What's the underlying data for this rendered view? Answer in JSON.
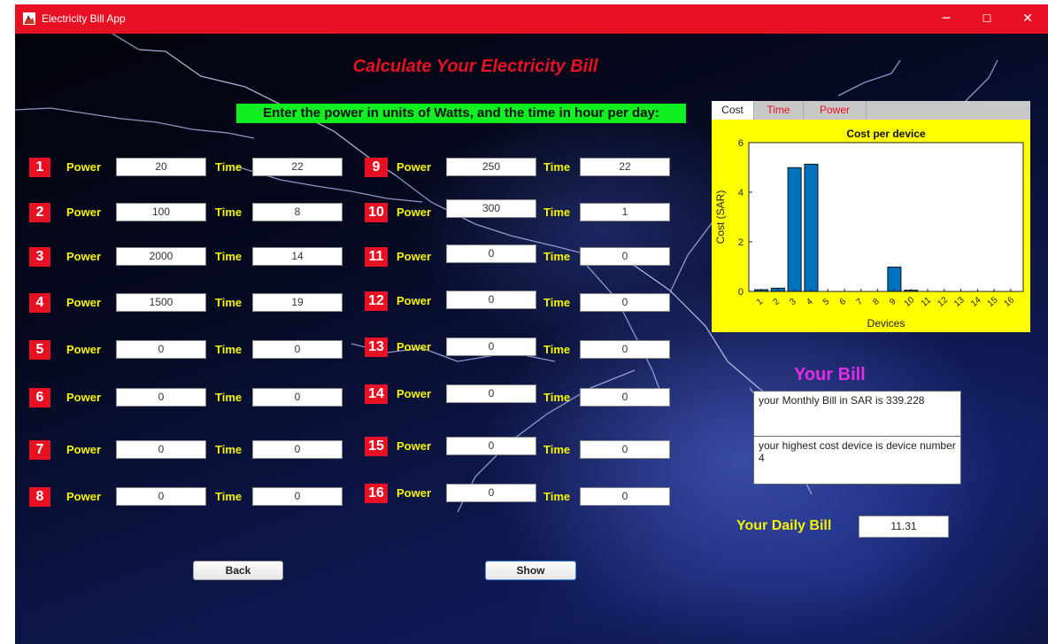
{
  "window": {
    "title": "Electricity Bill App",
    "minimize_glyph": "─",
    "maximize_glyph": "☐",
    "close_glyph": "✕",
    "app_icon": "mountain-app-icon",
    "accent": "#e81123"
  },
  "header": {
    "title": "Calculate Your Electricity Bill",
    "instructions": "Enter the power in units of Watts, and the time in hour per day:"
  },
  "labels": {
    "power": "Power",
    "time": "Time"
  },
  "devices": [
    {
      "num": "1",
      "power": "20",
      "time": "22"
    },
    {
      "num": "2",
      "power": "100",
      "time": "8"
    },
    {
      "num": "3",
      "power": "2000",
      "time": "14"
    },
    {
      "num": "4",
      "power": "1500",
      "time": "19"
    },
    {
      "num": "5",
      "power": "0",
      "time": "0"
    },
    {
      "num": "6",
      "power": "0",
      "time": "0"
    },
    {
      "num": "7",
      "power": "0",
      "time": "0"
    },
    {
      "num": "8",
      "power": "0",
      "time": "0"
    },
    {
      "num": "9",
      "power": "250",
      "time": "22"
    },
    {
      "num": "10",
      "power": "300",
      "time": "1"
    },
    {
      "num": "11",
      "power": "0",
      "time": "0"
    },
    {
      "num": "12",
      "power": "0",
      "time": "0"
    },
    {
      "num": "13",
      "power": "0",
      "time": "0"
    },
    {
      "num": "14",
      "power": "0",
      "time": "0"
    },
    {
      "num": "15",
      "power": "0",
      "time": "0"
    },
    {
      "num": "16",
      "power": "0",
      "time": "0"
    }
  ],
  "buttons": {
    "back": "Back",
    "show": "Show"
  },
  "tabs": [
    {
      "label": "Cost",
      "active": true
    },
    {
      "label": "Time",
      "active": false
    },
    {
      "label": "Power",
      "active": false
    }
  ],
  "chart_data": {
    "type": "bar",
    "title": "Cost per device",
    "xlabel": "Devices",
    "ylabel": "Cost (SAR)",
    "ylim": [
      0,
      6
    ],
    "yticks": [
      0,
      2,
      4,
      6
    ],
    "categories": [
      "1",
      "2",
      "3",
      "4",
      "5",
      "6",
      "7",
      "8",
      "9",
      "10",
      "11",
      "12",
      "13",
      "14",
      "15",
      "16"
    ],
    "values": [
      0.07,
      0.13,
      4.99,
      5.13,
      0,
      0,
      0,
      0,
      0.98,
      0.05,
      0,
      0,
      0,
      0,
      0,
      0
    ],
    "bar_color": "#0072bd",
    "background": "#ffff00"
  },
  "bill": {
    "heading": "Your Bill",
    "monthly_text": "your Monthly Bill in SAR is 339.228",
    "highest_text": "your highest cost device is device number 4",
    "daily_label": "Your Daily Bill",
    "daily_value": "11.31"
  }
}
